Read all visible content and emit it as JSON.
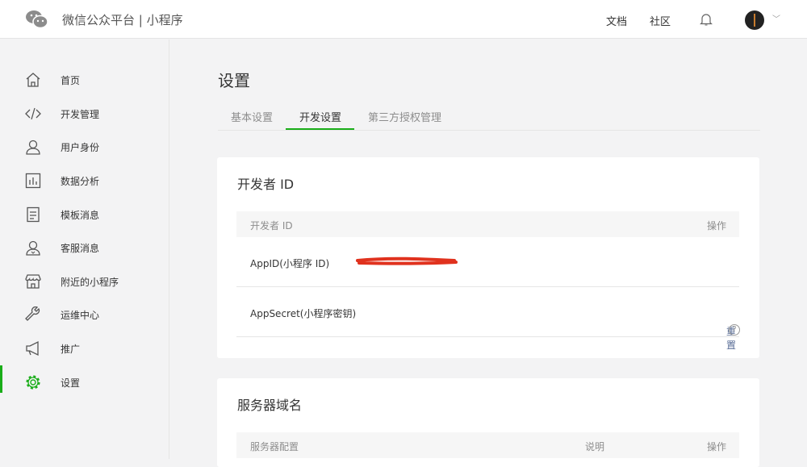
{
  "header": {
    "brand": "微信公众平台 | 小程序",
    "nav": [
      "文档",
      "社区"
    ]
  },
  "sidebar": {
    "items": [
      {
        "label": "首页",
        "icon": "home-icon"
      },
      {
        "label": "开发管理",
        "icon": "code-icon"
      },
      {
        "label": "用户身份",
        "icon": "user-icon"
      },
      {
        "label": "数据分析",
        "icon": "chart-icon"
      },
      {
        "label": "模板消息",
        "icon": "document-icon"
      },
      {
        "label": "客服消息",
        "icon": "service-icon"
      },
      {
        "label": "附近的小程序",
        "icon": "store-icon"
      },
      {
        "label": "运维中心",
        "icon": "wrench-icon"
      },
      {
        "label": "推广",
        "icon": "megaphone-icon"
      },
      {
        "label": "设置",
        "icon": "gear-icon"
      }
    ],
    "active": 9
  },
  "page": {
    "title": "设置",
    "tabs": [
      "基本设置",
      "开发设置",
      "第三方授权管理"
    ],
    "active_tab": 1
  },
  "developer": {
    "title": "开发者 ID",
    "col1": "开发者 ID",
    "col2": "操作",
    "rows": [
      {
        "label": "AppID(小程序 ID)"
      },
      {
        "label": "AppSecret(小程序密钥)",
        "action": "重置",
        "help": "?"
      }
    ]
  },
  "server": {
    "title": "服务器域名",
    "cols": [
      "服务器配置",
      "说明",
      "操作"
    ]
  },
  "colors": {
    "accent": "#1aad19",
    "link": "#576b95"
  }
}
